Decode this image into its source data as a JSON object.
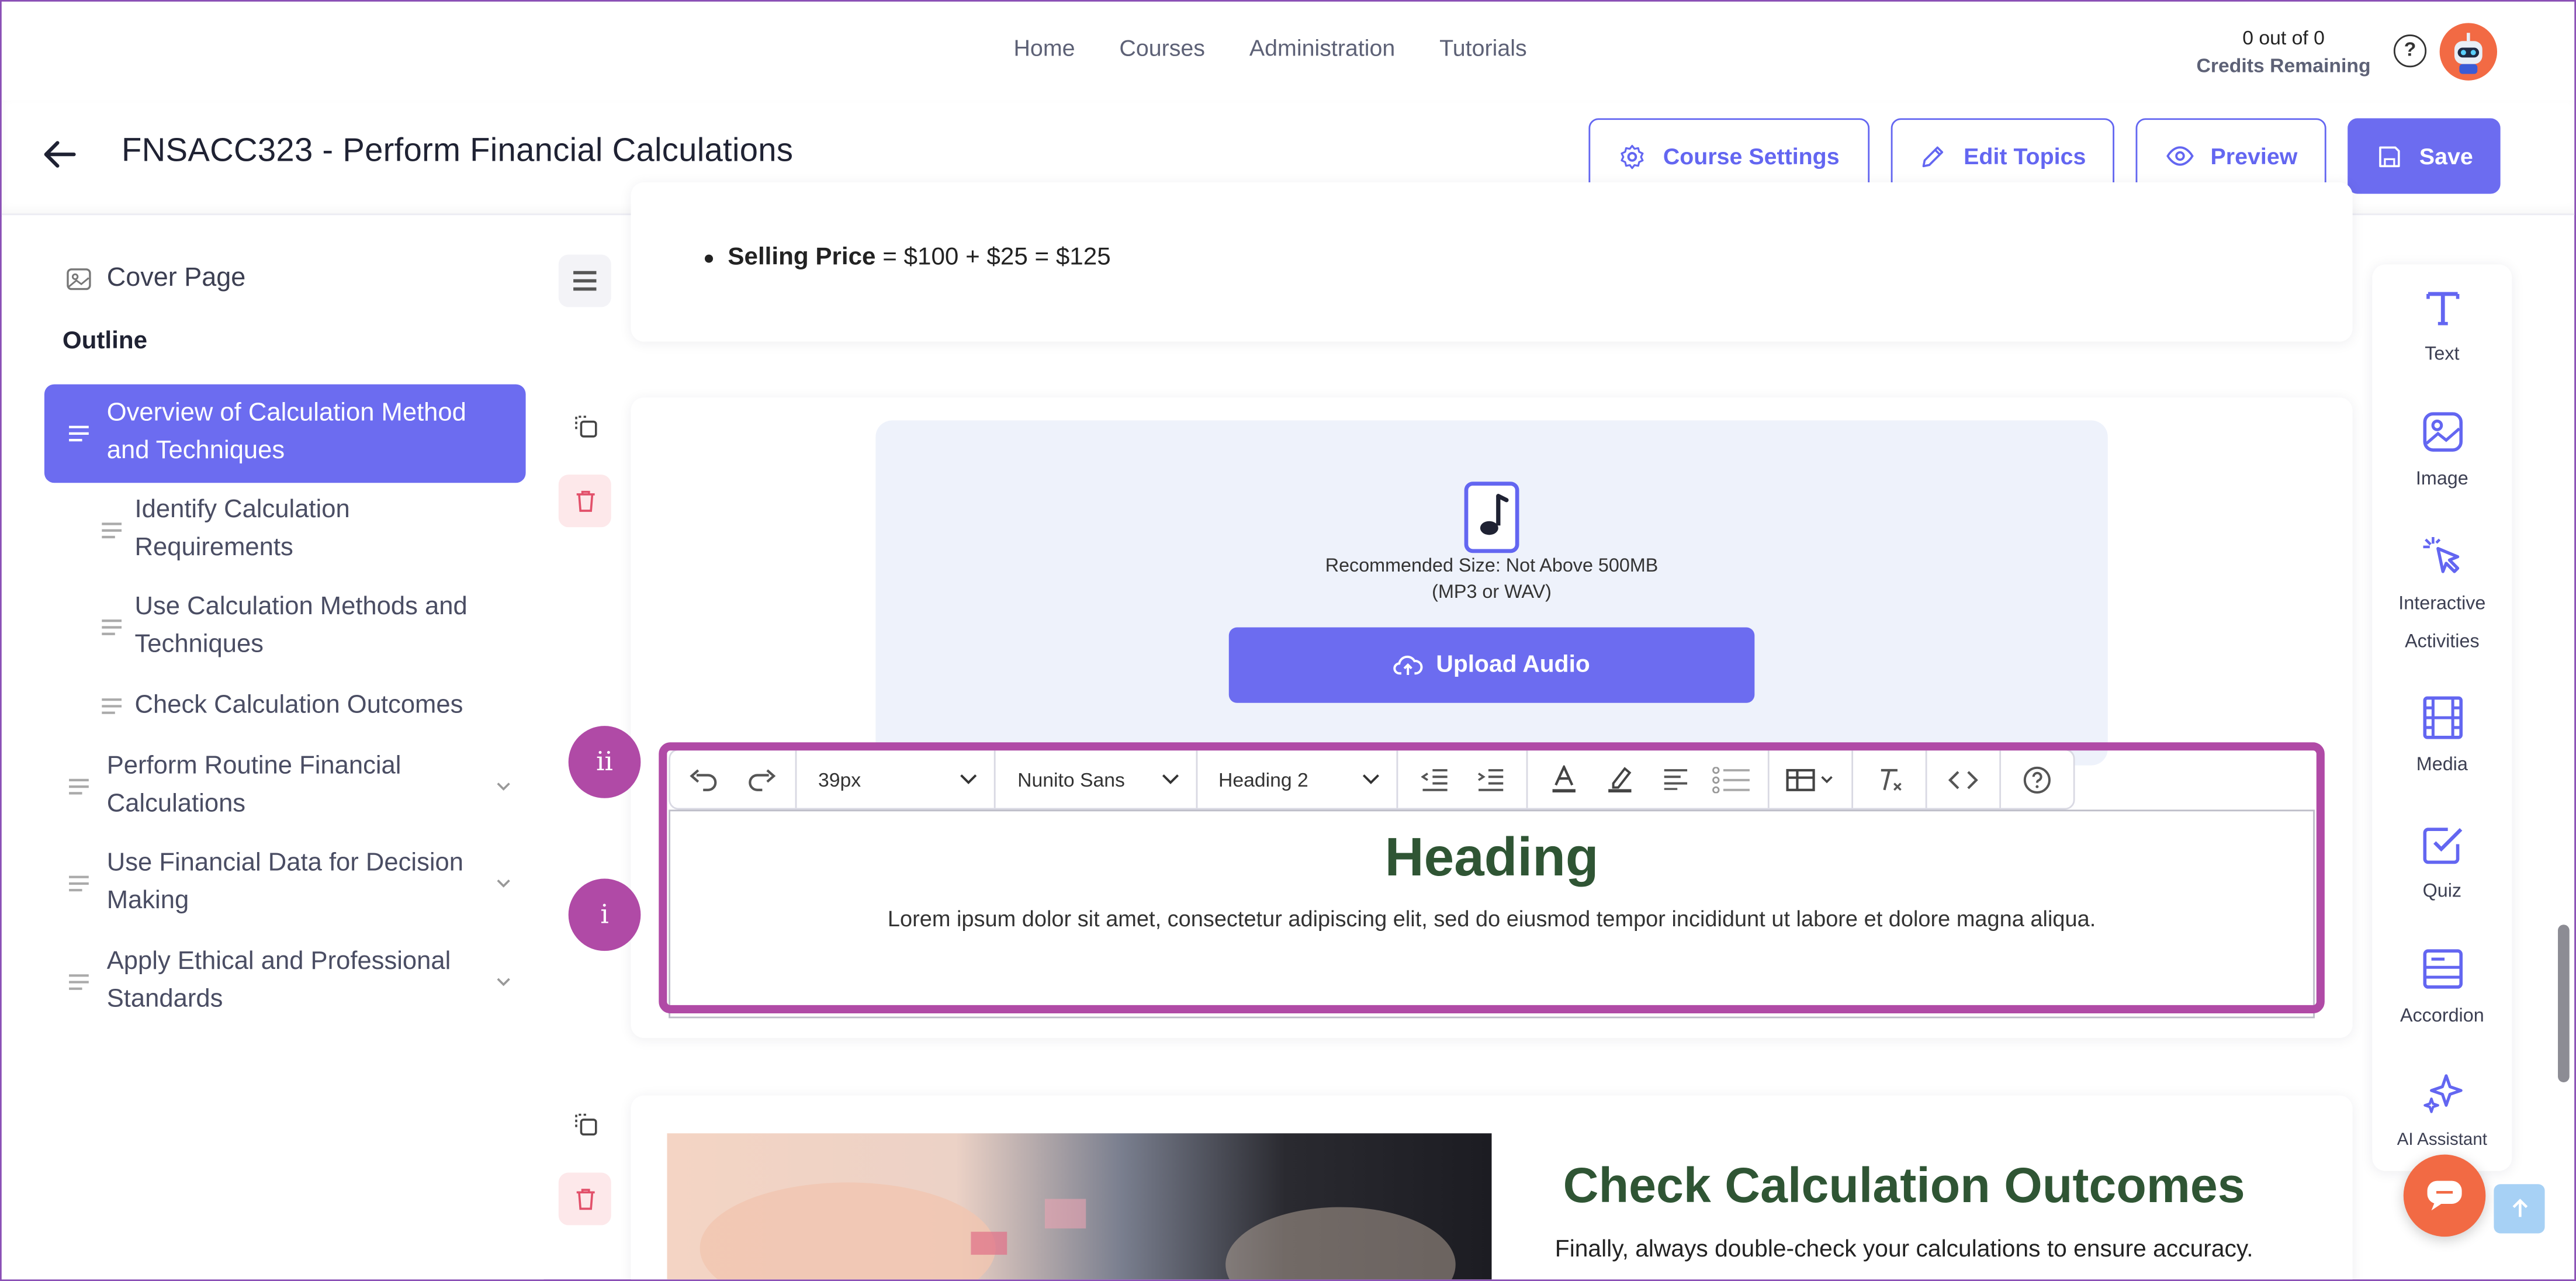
{
  "nav": {
    "links": [
      "Home",
      "Courses",
      "Administration",
      "Tutorials"
    ]
  },
  "credits": {
    "line1": "0 out of 0",
    "line2": "Credits Remaining"
  },
  "header": {
    "title": "FNSACC323 - Perform Financial Calculations",
    "buttons": {
      "course_settings": "Course Settings",
      "edit_topics": "Edit Topics",
      "preview": "Preview",
      "save": "Save"
    }
  },
  "sidebar": {
    "cover": "Cover Page",
    "outline": "Outline",
    "items": [
      {
        "label": "Overview of Calculation Method and Techniques"
      },
      {
        "label": "Identify Calculation Requirements"
      },
      {
        "label": "Use Calculation Methods and Techniques"
      },
      {
        "label": "Check Calculation Outcomes"
      },
      {
        "label": "Perform Routine Financial Calculations"
      },
      {
        "label": "Use Financial Data for Decision Making"
      },
      {
        "label": "Apply Ethical and Professional Standards"
      }
    ]
  },
  "content": {
    "bullet_label": "Selling Price",
    "bullet_value": " = $100 + $25 = $125",
    "audio": {
      "recommended": "Recommended Size: Not Above 500MB",
      "formats": "(MP3 or WAV)",
      "upload": "Upload Audio"
    },
    "toolbar": {
      "font_size": "39px",
      "font_family": "Nunito Sans",
      "block_format": "Heading 2"
    },
    "editor": {
      "heading": "Heading",
      "body": "Lorem ipsum dolor sit amet, consectetur adipiscing elit, sed do eiusmod tempor incididunt ut labore et dolore magna aliqua."
    },
    "badges": {
      "toolbar": "ii",
      "editor": "i"
    },
    "next_section": {
      "heading": "Check Calculation Outcomes",
      "body": "Finally, always double-check your calculations to ensure accuracy."
    }
  },
  "tools": [
    {
      "label": "Text",
      "icon": "text-icon"
    },
    {
      "label": "Image",
      "icon": "image-icon"
    },
    {
      "label": "Interactive Activities",
      "icon": "pointer-click-icon"
    },
    {
      "label": "Media",
      "icon": "film-icon"
    },
    {
      "label": "Quiz",
      "icon": "checkbox-icon"
    },
    {
      "label": "Accordion",
      "icon": "accordion-icon"
    },
    {
      "label": "AI Assistant",
      "icon": "sparkles-icon"
    }
  ],
  "colors": {
    "accent": "#6c6cf0",
    "highlight": "#b04aa6",
    "heading_green": "#2f5534"
  }
}
